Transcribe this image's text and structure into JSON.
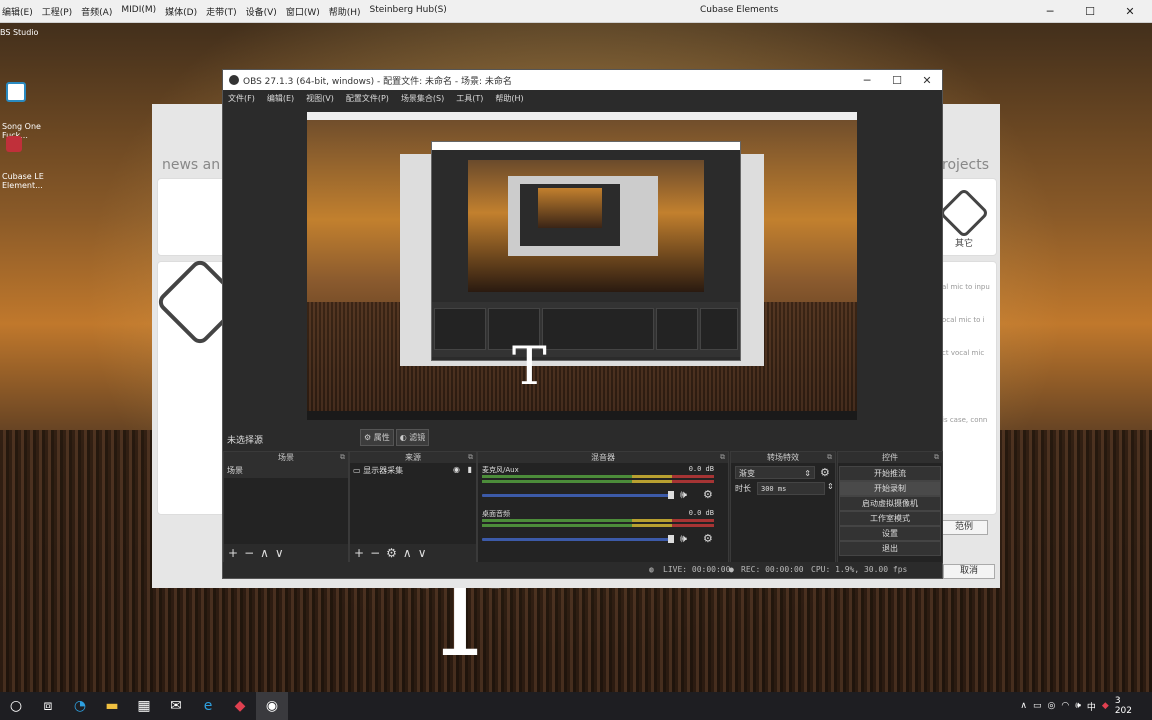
{
  "cubase": {
    "menu": [
      "编辑(E)",
      "工程(P)",
      "音频(A)",
      "MIDI(M)",
      "媒体(D)",
      "走带(T)",
      "设备(V)",
      "窗口(W)",
      "帮助(H)",
      "Steinberg Hub(S)"
    ],
    "title": "Cubase Elements",
    "hub_news": "news an",
    "hub_projects": "rojects",
    "hub_other": "其它",
    "hub_right_texts": [
      "al mic to inpu",
      "ocal mic to i",
      "ct vocal mic",
      "is case, conn"
    ],
    "hub_btn_cancel": "取消",
    "hub_btn_other": "范例"
  },
  "desktop_icons": [
    {
      "label": "BS Studio"
    },
    {
      "label": "Song One\nFuck..."
    },
    {
      "label": "Cubase LE\nElement..."
    }
  ],
  "obs": {
    "title": "OBS 27.1.3 (64-bit, windows) - 配置文件: 未命名 - 场景: 未命名",
    "menu": [
      "文件(F)",
      "编辑(E)",
      "视图(V)",
      "配置文件(P)",
      "场景集合(S)",
      "工具(T)",
      "帮助(H)"
    ],
    "no_source": "未选择源",
    "properties_btn": "属性",
    "filters_btn": "滤镜",
    "docks": {
      "scenes": "场景",
      "sources": "来源",
      "mixer": "混音器",
      "transitions": "转场特效",
      "controls": "控件"
    },
    "scene_item": "场景",
    "source_item": "显示器采集",
    "mixer_tracks": [
      {
        "name": "麦克风/Aux",
        "db": "0.0 dB"
      },
      {
        "name": "桌面音频",
        "db": "0.0 dB"
      }
    ],
    "transition": {
      "value": "渐变",
      "duration_label": "时长",
      "duration": "300 ms"
    },
    "controls": [
      "开始推流",
      "开始录制",
      "启动虚拟摄像机",
      "工作室模式",
      "设置",
      "退出"
    ],
    "status": {
      "live": "LIVE: 00:00:00",
      "rec": "REC: 00:00:00",
      "cpu": "CPU: 1.9%, 30.00 fps"
    }
  },
  "taskbar": {
    "tray_time": "3",
    "tray_date": "202",
    "tray_lang": "中"
  }
}
